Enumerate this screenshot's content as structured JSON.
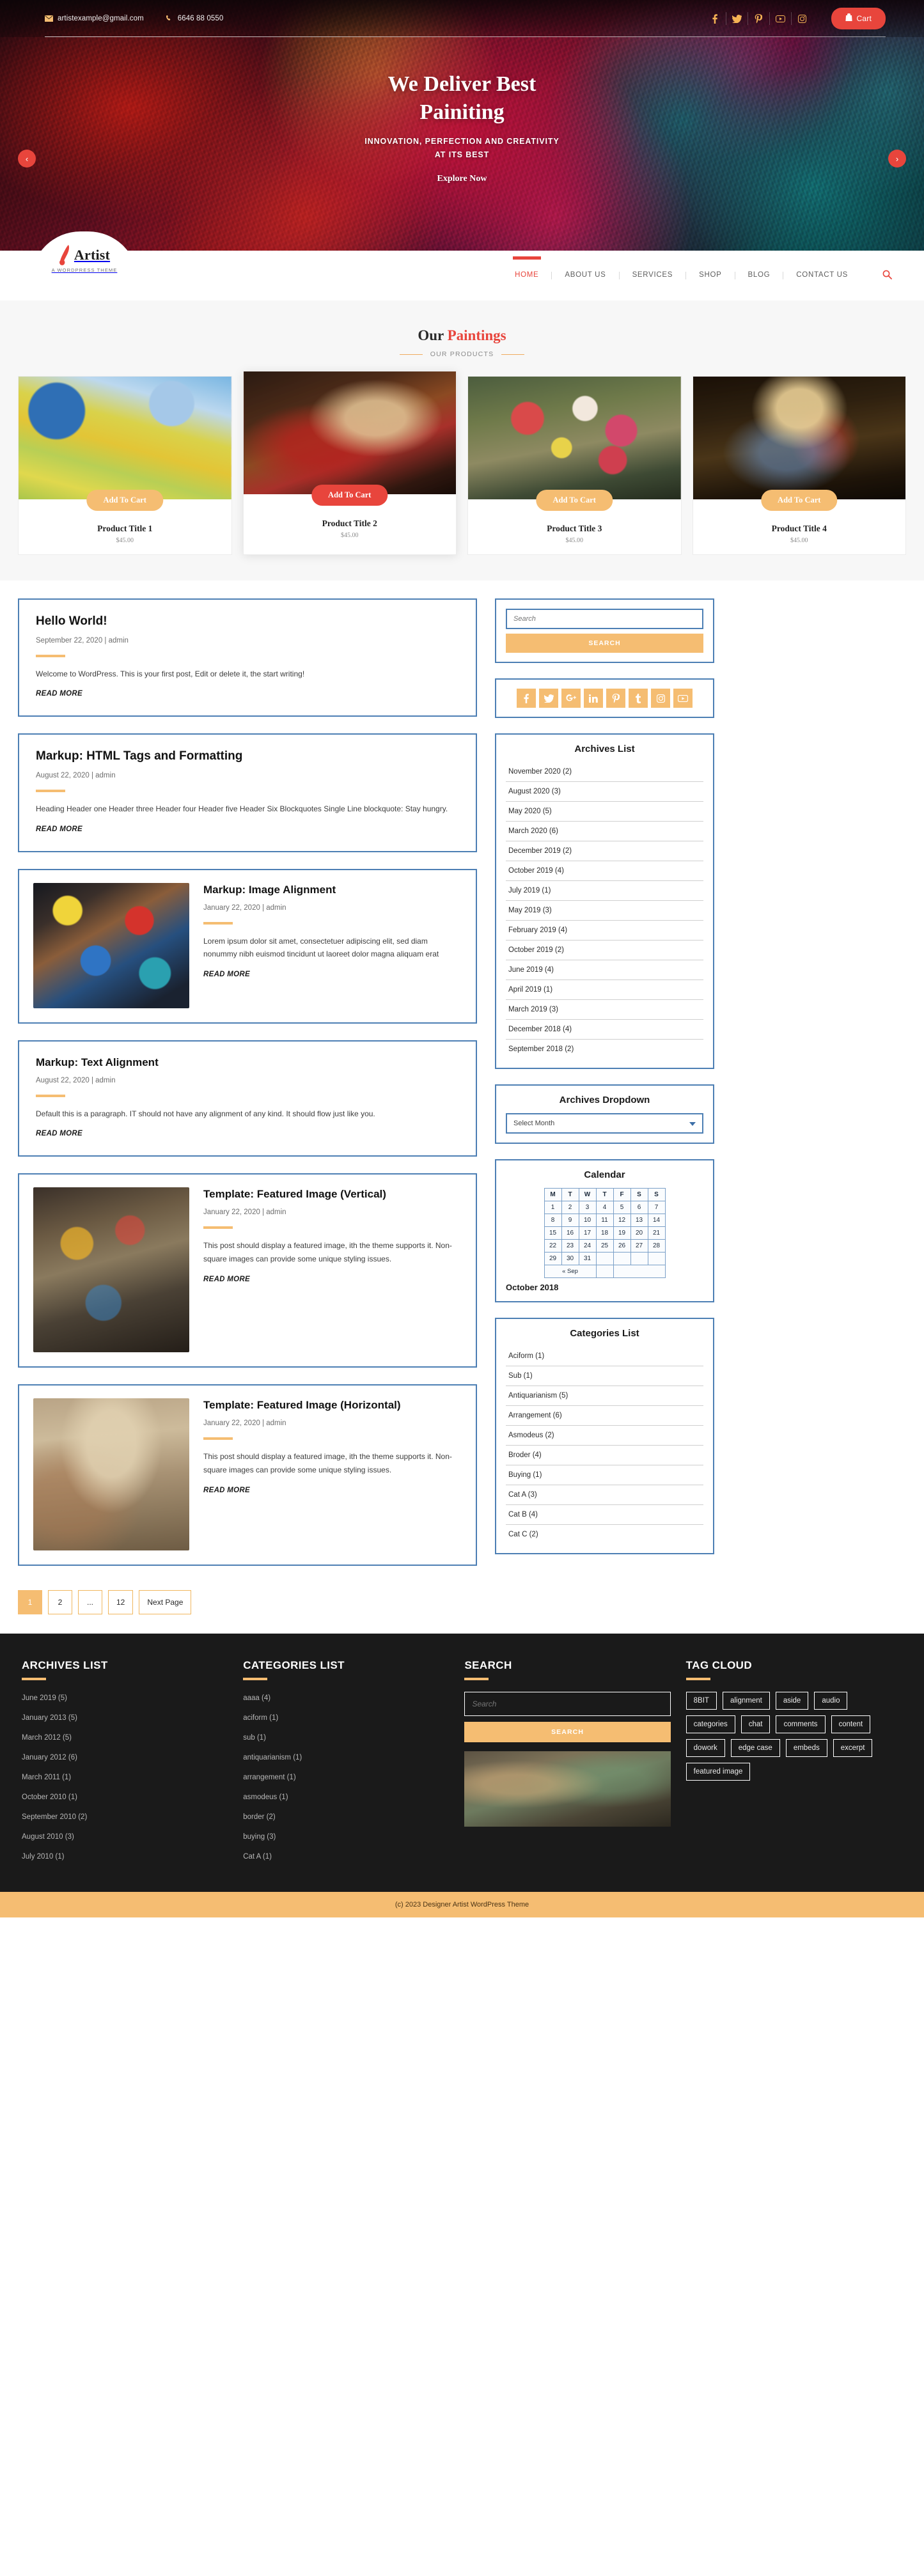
{
  "topbar": {
    "email": "artistexample@gmail.com",
    "phone": "6646 88 0550",
    "cart_label": "Cart",
    "social": [
      {
        "name": "facebook",
        "glyph": "f"
      },
      {
        "name": "twitter",
        "glyph": "ᵗ"
      },
      {
        "name": "pinterest",
        "glyph": "р"
      },
      {
        "name": "youtube",
        "glyph": "▸"
      },
      {
        "name": "instagram",
        "glyph": "◎"
      }
    ]
  },
  "hero": {
    "title_line1": "We Deliver Best",
    "title_line2": "Painiting",
    "sub_line1": "INNOVATION, PERFECTION AND CREATIVITY",
    "sub_line2": "AT ITS BEST",
    "cta": "Explore Now",
    "prev": "‹",
    "next": "›"
  },
  "brand": {
    "name": "Artist",
    "tagline": "A WORDPRESS THEME"
  },
  "nav": {
    "items": [
      {
        "label": "HOME",
        "active": true
      },
      {
        "label": "ABOUT US",
        "active": false
      },
      {
        "label": "SERVICES",
        "active": false
      },
      {
        "label": "SHOP",
        "active": false
      },
      {
        "label": "BLOG",
        "active": false
      },
      {
        "label": "CONTACT US",
        "active": false
      }
    ]
  },
  "products_section": {
    "title_plain": "Our ",
    "title_accent": "Paintings",
    "subtitle": "OUR PRODUCTS",
    "items": [
      {
        "title": "Product Title 1",
        "price": "$45.00",
        "button": "Add To Cart",
        "hot": false
      },
      {
        "title": "Product Title 2",
        "price": "$45.00",
        "button": "Add To Cart",
        "hot": true
      },
      {
        "title": "Product Title 3",
        "price": "$45.00",
        "button": "Add To Cart",
        "hot": false
      },
      {
        "title": "Product Title 4",
        "price": "$45.00",
        "button": "Add To Cart",
        "hot": false
      }
    ]
  },
  "posts": [
    {
      "title": "Hello World!",
      "meta": "September 22, 2020 | admin",
      "excerpt": "Welcome to WordPress. This is your first post, Edit or delete it, the start writing!",
      "read_more": "READ MORE"
    },
    {
      "title": "Markup: HTML Tags and Formatting",
      "meta": "August 22, 2020 | admin",
      "excerpt": "Heading Header one Header three Header four Header five Header Six Blockquotes Single Line blockquote: Stay hungry.",
      "read_more": "READ MORE"
    },
    {
      "title": "Markup: Image Alignment",
      "meta": "January 22, 2020 | admin",
      "excerpt": "Lorem ipsum dolor sit amet, consectetuer adipiscing elit, sed diam nonummy nibh euismod tincidunt ut laoreet dolor magna aliquam erat",
      "read_more": "READ MORE"
    },
    {
      "title": "Markup: Text Alignment",
      "meta": "August 22, 2020 | admin",
      "excerpt": "Default this is a paragraph. IT should not have any alignment of any kind. It should flow just like you.",
      "read_more": "READ MORE"
    },
    {
      "title": "Template: Featured Image (Vertical)",
      "meta": "January 22, 2020 | admin",
      "excerpt": "This post should display a featured image, ith the theme supports it. Non-square images can provide some unique styling issues.",
      "read_more": "READ MORE"
    },
    {
      "title": "Template: Featured Image (Horizontal)",
      "meta": "January 22, 2020 | admin",
      "excerpt": "This post should display a featured image, ith the theme supports it. Non-square images can provide some unique styling issues.",
      "read_more": "READ MORE"
    }
  ],
  "pagination": [
    {
      "label": "1",
      "current": true
    },
    {
      "label": "2",
      "current": false
    },
    {
      "label": "...",
      "current": false
    },
    {
      "label": "12",
      "current": false
    },
    {
      "label": "Next Page",
      "current": false
    }
  ],
  "sidebar": {
    "search": {
      "placeholder": "Search",
      "button": "SEARCH"
    },
    "social": [
      {
        "name": "facebook",
        "glyph": "f"
      },
      {
        "name": "twitter",
        "glyph": "ᵗ"
      },
      {
        "name": "google-plus",
        "glyph": "G⁺"
      },
      {
        "name": "linkedin",
        "glyph": "in"
      },
      {
        "name": "pinterest",
        "glyph": "р"
      },
      {
        "name": "tumblr",
        "glyph": "t"
      },
      {
        "name": "instagram",
        "glyph": "◎"
      },
      {
        "name": "youtube",
        "glyph": "▸"
      }
    ],
    "archives": {
      "title": "Archives List",
      "items": [
        "November 2020 (2)",
        "August 2020 (3)",
        "May 2020 (5)",
        "March 2020 (6)",
        "December 2019 (2)",
        "October 2019 (4)",
        "July 2019 (1)",
        "May 2019 (3)",
        "February 2019 (4)",
        "October 2019 (2)",
        "June 2019 (4)",
        "April 2019 (1)",
        "March 2019 (3)",
        "December 2018 (4)",
        "September 2018 (2)"
      ]
    },
    "archives_dropdown": {
      "title": "Archives Dropdown",
      "selected": "Select Month"
    },
    "calendar": {
      "title": "Calendar",
      "weekdays": [
        "M",
        "T",
        "W",
        "T",
        "F",
        "S",
        "S"
      ],
      "weeks": [
        [
          "1",
          "2",
          "3",
          "4",
          "5",
          "6",
          "7"
        ],
        [
          "8",
          "9",
          "10",
          "11",
          "12",
          "13",
          "14"
        ],
        [
          "15",
          "16",
          "17",
          "18",
          "19",
          "20",
          "21"
        ],
        [
          "22",
          "23",
          "24",
          "25",
          "26",
          "27",
          "28"
        ],
        [
          "29",
          "30",
          "31",
          "",
          "",
          "",
          ""
        ]
      ],
      "prev_link": "« Sep",
      "month_label": "October 2018"
    },
    "categories": {
      "title": "Categories List",
      "items": [
        "Aciform (1)",
        "Sub (1)",
        "Antiquarianism (5)",
        "Arrangement (6)",
        "Asmodeus (2)",
        "Broder (4)",
        "Buying (1)",
        "Cat A (3)",
        "Cat B (4)",
        "Cat C (2)"
      ]
    }
  },
  "footer": {
    "archives": {
      "title": "ARCHIVES LIST",
      "items": [
        "June 2019 (5)",
        "January  2013 (5)",
        "March 2012 (5)",
        "January  2012 (6)",
        "March  2011 (1)",
        "October 2010 (1)",
        "September 2010 (2)",
        "August 2010 (3)",
        "July 2010 (1)"
      ]
    },
    "categories": {
      "title": "CATEGORIES LIST",
      "items": [
        "aaaa (4)",
        "aciform (1)",
        "sub (1)",
        "antiquarianism (1)",
        "arrangement (1)",
        "asmodeus (1)",
        "border (2)",
        "buying (3)",
        "Cat A (1)"
      ]
    },
    "search": {
      "title": "SEARCH",
      "placeholder": "Search",
      "button": "SEARCH"
    },
    "tagcloud": {
      "title": "TAG CLOUD",
      "tags": [
        "8BIT",
        "alignment",
        "aside",
        "audio",
        "categories",
        "chat",
        "comments",
        "content",
        "dowork",
        "edge case",
        "embeds",
        "excerpt",
        "featured image"
      ]
    },
    "copyright": "(c) 2023 Designer Artist  WordPress Theme"
  }
}
